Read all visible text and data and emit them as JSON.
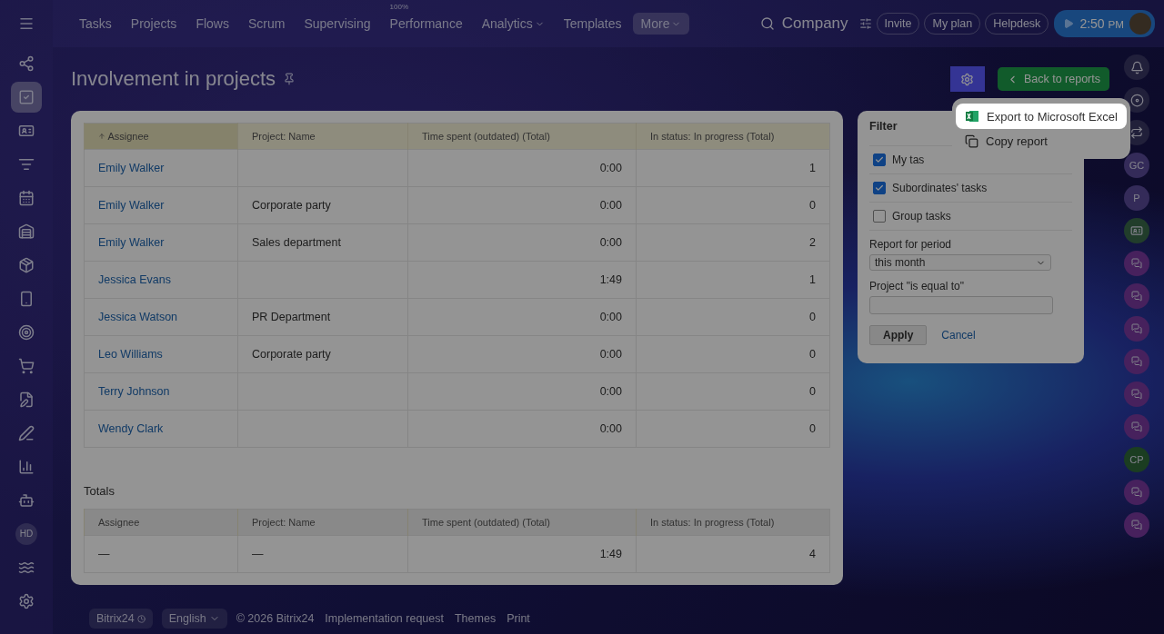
{
  "top_nav": {
    "tabs": [
      {
        "label": "Tasks",
        "selected": false
      },
      {
        "label": "Projects",
        "selected": false
      },
      {
        "label": "Flows",
        "selected": false
      },
      {
        "label": "Scrum",
        "selected": false
      },
      {
        "label": "Supervising",
        "selected": false
      },
      {
        "label": "Performance",
        "badge": "100%",
        "selected": false
      },
      {
        "label": "Analytics",
        "dropdown": true,
        "selected": false
      },
      {
        "label": "Templates",
        "selected": false
      },
      {
        "label": "More",
        "dropdown": true,
        "selected": true
      }
    ],
    "search_label": "Company",
    "buttons": [
      "Invite",
      "My plan",
      "Helpdesk"
    ],
    "timer": {
      "time": "2:50",
      "suffix": "PM"
    }
  },
  "sidebar": {
    "items": [
      {
        "kind": "icon",
        "selected": false
      },
      {
        "kind": "icon",
        "selected": true
      },
      {
        "kind": "icon",
        "selected": false
      },
      {
        "kind": "icon",
        "selected": false
      },
      {
        "kind": "icon",
        "selected": false
      },
      {
        "kind": "icon",
        "selected": false
      },
      {
        "kind": "icon",
        "selected": false
      },
      {
        "kind": "icon",
        "selected": false
      },
      {
        "kind": "icon",
        "selected": false
      },
      {
        "kind": "icon",
        "selected": false
      },
      {
        "kind": "icon",
        "selected": false
      },
      {
        "kind": "icon",
        "selected": false
      },
      {
        "kind": "icon",
        "selected": false
      },
      {
        "kind": "icon",
        "selected": false
      },
      {
        "kind": "avatar",
        "label": "HD",
        "selected": false
      },
      {
        "kind": "icon",
        "selected": false
      },
      {
        "kind": "icon",
        "selected": false
      }
    ]
  },
  "page": {
    "title": "Involvement in projects",
    "back_button": "Back to reports"
  },
  "menu": {
    "items": [
      {
        "label": "Export to Microsoft Excel",
        "kind": "excel",
        "highlighted": true
      },
      {
        "label": "Copy report",
        "kind": "copy",
        "highlighted": false
      }
    ]
  },
  "table": {
    "columns": [
      {
        "label": "Assignee",
        "sorted": true
      },
      {
        "label": "Project: Name",
        "sorted": false
      },
      {
        "label": "Time spent (outdated) (Total)",
        "sorted": false
      },
      {
        "label": "In status: In progress (Total)",
        "sorted": false
      }
    ],
    "rows": [
      [
        "Emily Walker",
        "",
        "0:00",
        "1"
      ],
      [
        "Emily Walker",
        "Corporate party",
        "0:00",
        "0"
      ],
      [
        "Emily Walker",
        "Sales department",
        "0:00",
        "2"
      ],
      [
        "Jessica Evans",
        "",
        "1:49",
        "1"
      ],
      [
        "Jessica Watson",
        "PR Department",
        "0:00",
        "0"
      ],
      [
        "Leo Williams",
        "Corporate party",
        "0:00",
        "0"
      ],
      [
        "Terry Johnson",
        "",
        "0:00",
        "0"
      ],
      [
        "Wendy Clark",
        "",
        "0:00",
        "0"
      ]
    ]
  },
  "totals": {
    "title": "Totals",
    "columns": [
      "Assignee",
      "Project: Name",
      "Time spent (outdated) (Total)",
      "In status: In progress (Total)"
    ],
    "row": [
      "—",
      "—",
      "1:49",
      "4"
    ]
  },
  "filter": {
    "title": "Filter",
    "checkboxes": [
      {
        "label": "My tas",
        "checked": true
      },
      {
        "label": "Subordinates' tasks",
        "checked": true
      },
      {
        "label": "Group tasks",
        "checked": false
      }
    ],
    "period_label": "Report for period",
    "period_value": "this month",
    "project_label": "Project \"is equal to\"",
    "apply": "Apply",
    "cancel": "Cancel"
  },
  "right_rail": {
    "items": [
      {
        "kind": "bell"
      },
      {
        "kind": "icon"
      },
      {
        "kind": "chat"
      },
      {
        "kind": "avatar",
        "label": "GC"
      },
      {
        "kind": "avatar",
        "label": "P"
      },
      {
        "kind": "card"
      },
      {
        "kind": "chat_avatar"
      },
      {
        "kind": "chat_avatar"
      },
      {
        "kind": "chat_avatar"
      },
      {
        "kind": "chat_avatar"
      },
      {
        "kind": "chat_avatar"
      },
      {
        "kind": "chat_avatar"
      },
      {
        "kind": "project_avatar",
        "label": "CP"
      },
      {
        "kind": "chat_avatar"
      },
      {
        "kind": "chat_avatar"
      }
    ]
  },
  "footer": {
    "brand": "Bitrix24",
    "language": "English",
    "links": [
      "© 2026 Bitrix24",
      "Implementation request",
      "Themes",
      "Print"
    ]
  }
}
